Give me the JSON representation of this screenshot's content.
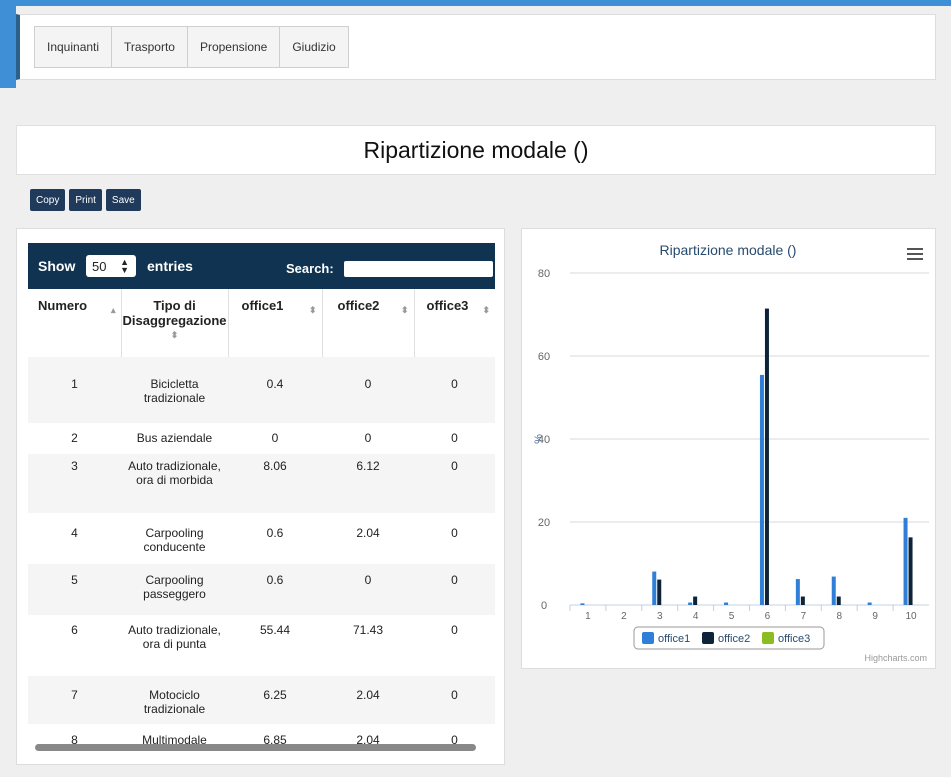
{
  "nav": {
    "tabs": [
      "Inquinanti",
      "Trasporto",
      "Propensione",
      "Giudizio"
    ]
  },
  "page": {
    "title": "Ripartizione modale ()"
  },
  "toolbar": {
    "copy_label": "Copy",
    "print_label": "Print",
    "save_label": "Save"
  },
  "table": {
    "show_label": "Show",
    "length_value": "50",
    "entries_label": "entries",
    "search_label": "Search:",
    "search_value": "",
    "columns": [
      "Numero",
      "Tipo di Disaggregazione",
      "office1",
      "office2",
      "office3"
    ],
    "rows": [
      {
        "numero": "1",
        "tipo": "Bicicletta tradizionale",
        "office1": "0.4",
        "office2": "0",
        "office3": "0"
      },
      {
        "numero": "2",
        "tipo": "Bus aziendale",
        "office1": "0",
        "office2": "0",
        "office3": "0"
      },
      {
        "numero": "3",
        "tipo": "Auto tradizionale, ora di morbida",
        "office1": "8.06",
        "office2": "6.12",
        "office3": "0"
      },
      {
        "numero": "4",
        "tipo": "Carpooling conducente",
        "office1": "0.6",
        "office2": "2.04",
        "office3": "0"
      },
      {
        "numero": "5",
        "tipo": "Carpooling passeggero",
        "office1": "0.6",
        "office2": "0",
        "office3": "0"
      },
      {
        "numero": "6",
        "tipo": "Auto tradizionale, ora di punta",
        "office1": "55.44",
        "office2": "71.43",
        "office3": "0"
      },
      {
        "numero": "7",
        "tipo": "Motociclo tradizionale",
        "office1": "6.25",
        "office2": "2.04",
        "office3": "0"
      },
      {
        "numero": "8",
        "tipo": "Multimodale",
        "office1": "6.85",
        "office2": "2.04",
        "office3": "0"
      }
    ]
  },
  "chart_data": {
    "type": "bar",
    "title": "Ripartizione modale ()",
    "ylabel": "%",
    "xlabel": "",
    "categories": [
      "1",
      "2",
      "3",
      "4",
      "5",
      "6",
      "7",
      "8",
      "9",
      "10"
    ],
    "ylim": [
      0,
      80
    ],
    "yticks": [
      0,
      20,
      40,
      60,
      80
    ],
    "grid": true,
    "legend_position": "bottom",
    "credit": "Highcharts.com",
    "series": [
      {
        "name": "office1",
        "color": "#2f7ed8",
        "values": [
          0.4,
          0,
          8.06,
          0.6,
          0.6,
          55.44,
          6.25,
          6.85,
          0.6,
          21
        ]
      },
      {
        "name": "office2",
        "color": "#0d233a",
        "values": [
          0,
          0,
          6.12,
          2.04,
          0,
          71.43,
          2.04,
          2.04,
          0,
          16.3
        ]
      },
      {
        "name": "office3",
        "color": "#8bbc21",
        "values": [
          0,
          0,
          0,
          0,
          0,
          0,
          0,
          0,
          0,
          0
        ]
      }
    ]
  }
}
